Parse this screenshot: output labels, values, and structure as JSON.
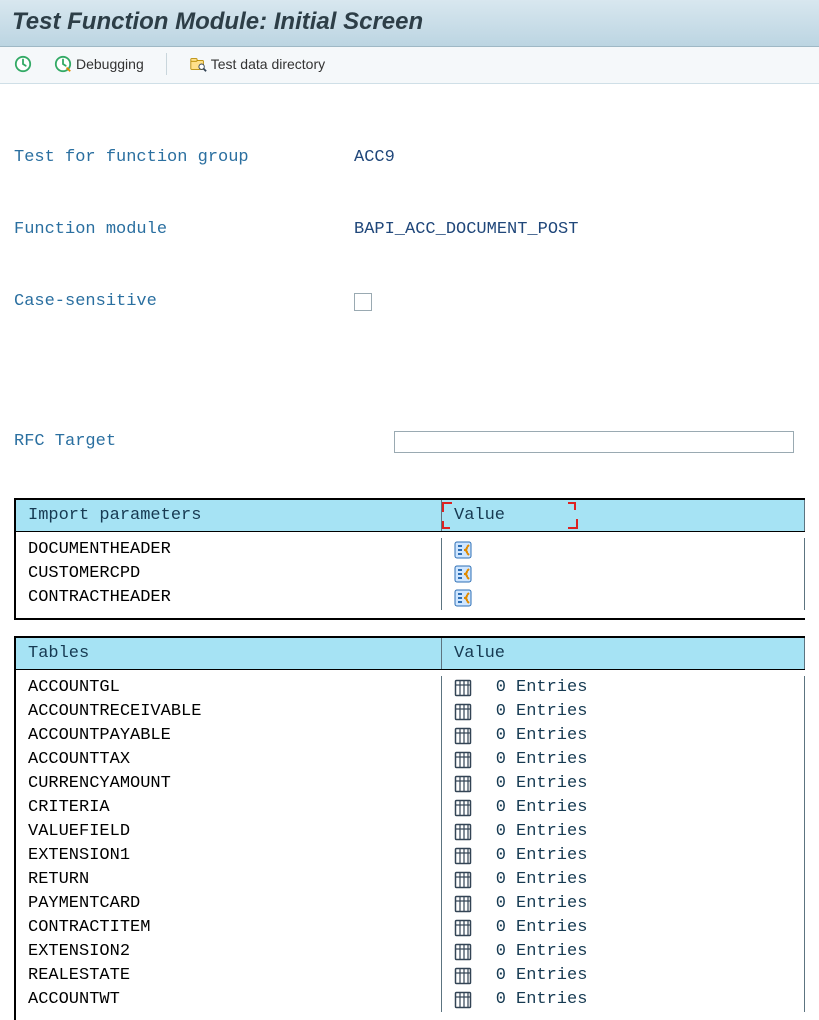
{
  "title": "Test Function Module: Initial Screen",
  "toolbar": {
    "debugging_label": "Debugging",
    "test_data_dir_label": "Test data directory"
  },
  "info": {
    "group_label": "Test for function group",
    "group_value": "ACC9",
    "fm_label": "Function module",
    "fm_value": "BAPI_ACC_DOCUMENT_POST",
    "case_label": "Case-sensitive",
    "case_checked": false,
    "rfc_label": "RFC Target",
    "rfc_value": ""
  },
  "import_params": {
    "header_name": "Import parameters",
    "header_value": "Value",
    "rows": [
      {
        "name": "DOCUMENTHEADER"
      },
      {
        "name": "CUSTOMERCPD"
      },
      {
        "name": "CONTRACTHEADER"
      }
    ]
  },
  "tables": {
    "header_name": "Tables",
    "header_value": "Value",
    "entries_word": "Entries",
    "rows": [
      {
        "name": "ACCOUNTGL",
        "count": 0
      },
      {
        "name": "ACCOUNTRECEIVABLE",
        "count": 0
      },
      {
        "name": "ACCOUNTPAYABLE",
        "count": 0
      },
      {
        "name": "ACCOUNTTAX",
        "count": 0
      },
      {
        "name": "CURRENCYAMOUNT",
        "count": 0
      },
      {
        "name": "CRITERIA",
        "count": 0
      },
      {
        "name": "VALUEFIELD",
        "count": 0
      },
      {
        "name": "EXTENSION1",
        "count": 0
      },
      {
        "name": "RETURN",
        "count": 0
      },
      {
        "name": "PAYMENTCARD",
        "count": 0
      },
      {
        "name": "CONTRACTITEM",
        "count": 0
      },
      {
        "name": "EXTENSION2",
        "count": 0
      },
      {
        "name": "REALESTATE",
        "count": 0
      },
      {
        "name": "ACCOUNTWT",
        "count": 0
      }
    ]
  }
}
